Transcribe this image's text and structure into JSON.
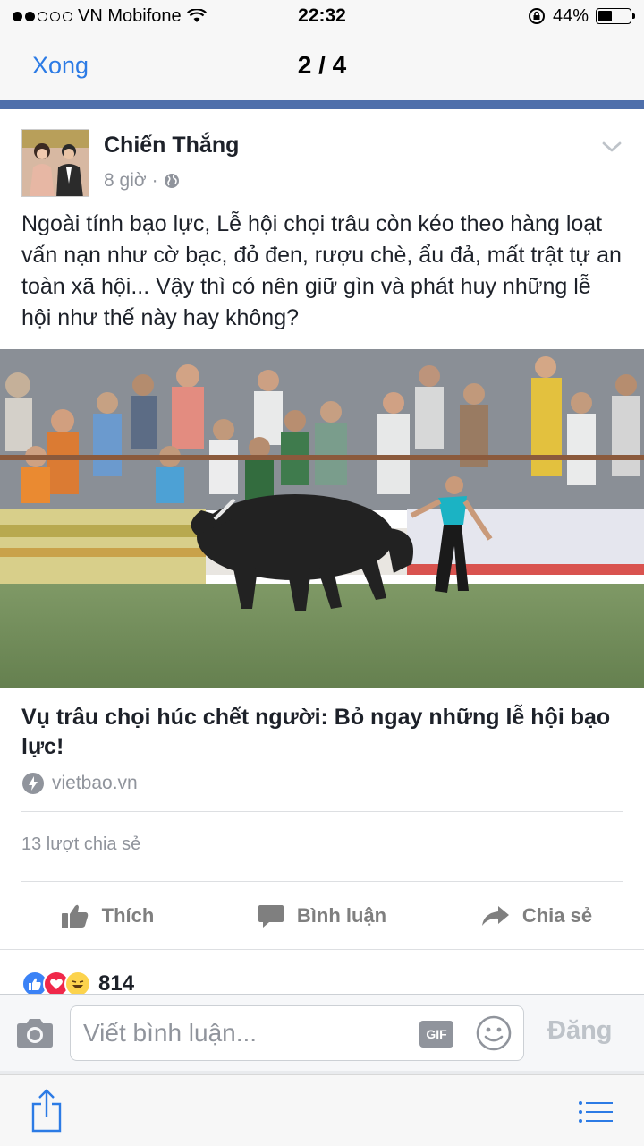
{
  "status_bar": {
    "carrier": "VN Mobifone",
    "signal_dots_filled": 2,
    "signal_dots_total": 5,
    "time": "22:32",
    "battery_percent": "44%",
    "battery_level": 0.44
  },
  "nav": {
    "done_label": "Xong",
    "title": "2 / 4"
  },
  "post": {
    "author": "Chiến Thắng",
    "time": "8 giờ",
    "privacy_icon": "globe-icon",
    "text": "Ngoài tính bạo lực, Lễ hội chọi trâu còn kéo theo hàng loạt vấn nạn như cờ bạc, đỏ đen, rượu chè, ẩu đả, mất trật tự an toàn xã hội... Vậy thì có nên giữ gìn và phát huy những lễ hội như thế này hay không?",
    "link": {
      "title": "Vụ trâu chọi húc chết người: Bỏ ngay những lễ hội bạo lực!",
      "source": "vietbao.vn"
    },
    "shares": "13 lượt chia sẻ",
    "actions": {
      "like": "Thích",
      "comment": "Bình luận",
      "share": "Chia sẻ"
    },
    "reactions": {
      "count": "814",
      "types": [
        "like-reaction-icon",
        "love-reaction-icon",
        "haha-reaction-icon"
      ]
    }
  },
  "composer": {
    "placeholder": "Viết bình luận...",
    "gif_label": "GIF",
    "post_label": "Đăng"
  },
  "colors": {
    "link_blue": "#2c7be5",
    "fb_bar": "#4e6fab",
    "like_blue": "#3b82f6",
    "love_red": "#f0284a",
    "haha_yellow": "#fcd34d"
  }
}
